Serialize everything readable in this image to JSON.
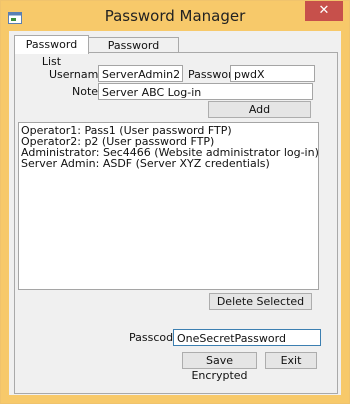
{
  "window": {
    "title": "Password Manager",
    "close_glyph": "✕",
    "app_icon": "app-icon"
  },
  "tabs": [
    {
      "label": "Password List",
      "active": true
    },
    {
      "label": "Password Generator",
      "active": false
    }
  ],
  "form": {
    "username_label": "Username",
    "username_value": "ServerAdmin2",
    "password_label": "Password",
    "password_value": "pwdX",
    "note_label": "Note",
    "note_value": "Server ABC Log-in",
    "add_label": "Add"
  },
  "list": {
    "items": [
      "Operator1: Pass1 (User password FTP)",
      "Operator2: p2 (User password FTP)",
      "Administrator: Sec4466 (Website administrator log-in)",
      "Server Admin: ASDF (Server XYZ credentials)"
    ],
    "delete_label": "Delete Selected"
  },
  "footer": {
    "passcode_label": "Passcode:",
    "passcode_value": "OneSecretPassword",
    "save_label": "Save Encrypted",
    "exit_label": "Exit"
  }
}
